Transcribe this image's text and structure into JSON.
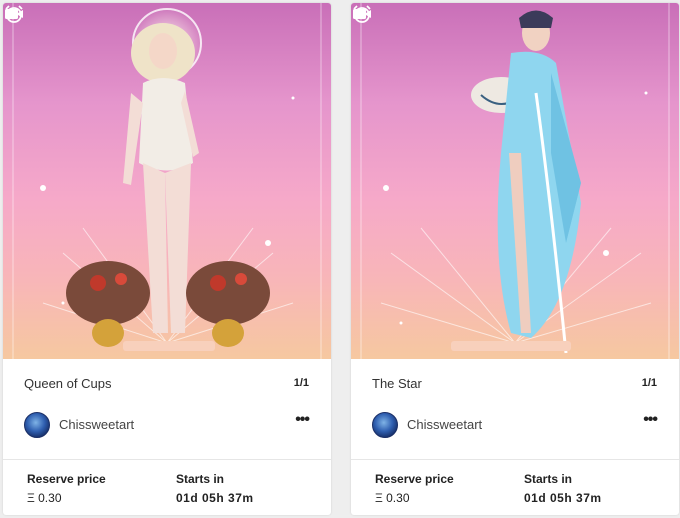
{
  "cards": [
    {
      "title": "Queen of Cups",
      "edition": "1/1",
      "creator": "Chissweetart",
      "more_label": "•••",
      "reserve_label": "Reserve price",
      "reserve_value": "Ξ 0.30",
      "starts_label": "Starts in",
      "starts_value": "01d 05h 37m"
    },
    {
      "title": "The Star",
      "edition": "1/1",
      "creator": "Chissweetart",
      "more_label": "•••",
      "reserve_label": "Reserve price",
      "reserve_value": "Ξ 0.30",
      "starts_label": "Starts in",
      "starts_value": "01d 05h 37m"
    }
  ]
}
